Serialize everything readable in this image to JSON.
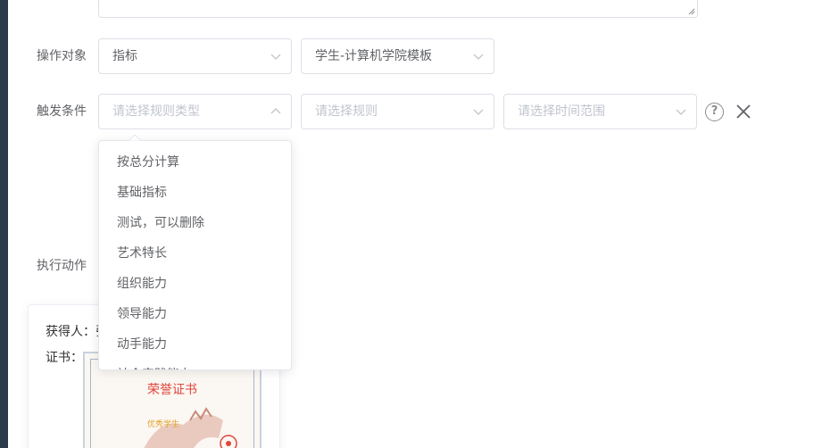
{
  "form": {
    "target_label": "操作对象",
    "trigger_label": "触发条件",
    "action_label": "执行动作"
  },
  "selects": {
    "target_type": {
      "value": "指标"
    },
    "target_template": {
      "value": "学生-计算机学院模板"
    },
    "rule_type": {
      "placeholder": "请选择规则类型"
    },
    "rule": {
      "placeholder": "请选择规则"
    },
    "time_range": {
      "placeholder": "请选择时间范围"
    }
  },
  "help_icon": {
    "glyph": "?"
  },
  "dropdown": {
    "options": [
      "按总分计算",
      "基础指标",
      "测试，可以删除",
      "艺术特长",
      "组织能力",
      "领导能力",
      "动手能力",
      "社会实践能力"
    ]
  },
  "card": {
    "recipient_label": "获得人：",
    "recipient_value": "张",
    "certificate_label": "证书：",
    "certificate_title": "荣誉证书",
    "certificate_gold_text": "优秀学生"
  },
  "colors": {
    "sidebar": "#2d3a4b",
    "border": "#dcdfe6",
    "placeholder": "#c0c4cc",
    "text": "#606266",
    "cert_title": "#e0463a"
  }
}
